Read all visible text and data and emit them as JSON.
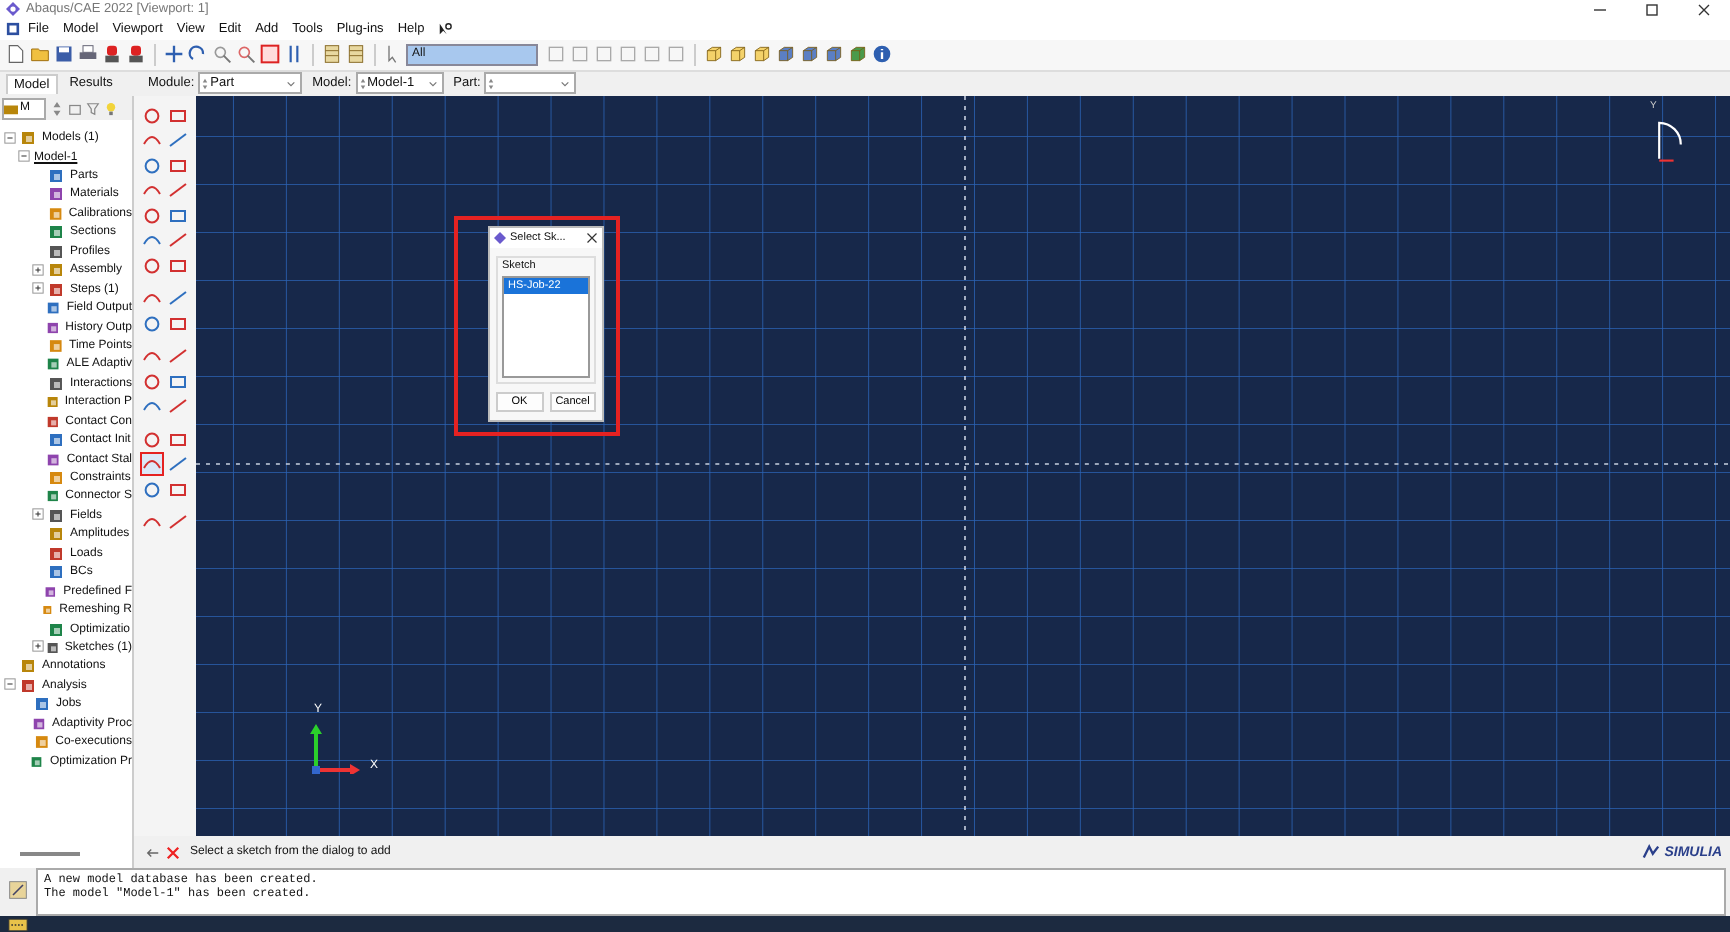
{
  "window": {
    "title": "Abaqus/CAE 2022 [Viewport: 1]"
  },
  "menu": [
    "File",
    "Model",
    "Viewport",
    "View",
    "Edit",
    "Add",
    "Tools",
    "Plug-ins",
    "Help"
  ],
  "toolbar": {
    "selection_filter": "All"
  },
  "tabs": [
    {
      "label": "Model",
      "selected": true
    },
    {
      "label": "Results",
      "selected": false
    }
  ],
  "context": [
    {
      "label": "Module:",
      "value": "Part"
    },
    {
      "label": "Model:",
      "value": "Model-1"
    },
    {
      "label": "Part:"
    }
  ],
  "tree_filter": {
    "value": "M"
  },
  "tree": [
    {
      "label": "Models (1)",
      "expanded": true,
      "children": [
        {
          "label": "Model-1",
          "expanded": true,
          "current": true,
          "children": [
            {
              "label": "Parts"
            },
            {
              "label": "Materials"
            },
            {
              "label": "Calibrations"
            },
            {
              "label": "Sections"
            },
            {
              "label": "Profiles"
            },
            {
              "label": "Assembly",
              "expanded": false
            },
            {
              "label": "Steps (1)",
              "expanded": false
            },
            {
              "label": "Field Output"
            },
            {
              "label": "History Outp"
            },
            {
              "label": "Time Points"
            },
            {
              "label": "ALE Adaptiv"
            },
            {
              "label": "Interactions"
            },
            {
              "label": "Interaction P"
            },
            {
              "label": "Contact Con"
            },
            {
              "label": "Contact Init"
            },
            {
              "label": "Contact Stal"
            },
            {
              "label": "Constraints"
            },
            {
              "label": "Connector S"
            },
            {
              "label": "Fields",
              "expanded": false
            },
            {
              "label": "Amplitudes"
            },
            {
              "label": "Loads"
            },
            {
              "label": "BCs"
            },
            {
              "label": "Predefined F"
            },
            {
              "label": "Remeshing R"
            },
            {
              "label": "Optimizatio"
            },
            {
              "label": "Sketches (1)",
              "expanded": false
            }
          ]
        }
      ]
    },
    {
      "label": "Annotations"
    },
    {
      "label": "Analysis",
      "expanded": true,
      "children": [
        {
          "label": "Jobs"
        },
        {
          "label": "Adaptivity Proc"
        },
        {
          "label": "Co-executions"
        },
        {
          "label": "Optimization Pr"
        }
      ]
    }
  ],
  "dialog": {
    "title": "Select Sk...",
    "group": "Sketch",
    "items": [
      {
        "label": "HS-Job-22",
        "selected": true
      }
    ],
    "buttons": [
      "OK",
      "Cancel"
    ]
  },
  "view_triad": {
    "y_label": "Y"
  },
  "axes": {
    "y_label": "Y",
    "x_label": "X"
  },
  "prompt": {
    "text": "Select a sketch from the dialog to add"
  },
  "brand": "SIMULIA",
  "messages": [
    "A new model database has been created.",
    "The model \"Model-1\" has been created."
  ]
}
